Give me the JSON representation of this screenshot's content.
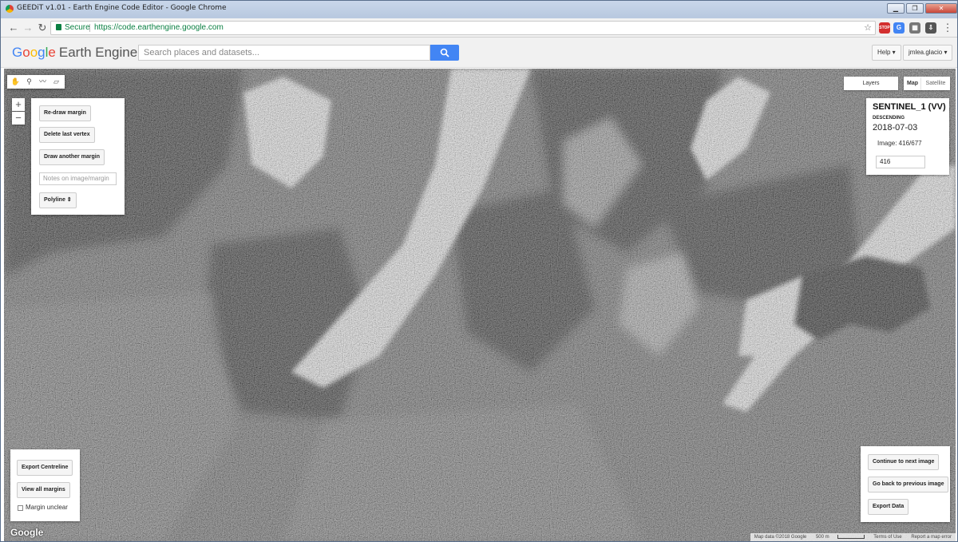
{
  "window": {
    "title": "GEEDiT v1.01 - Earth Engine Code Editor - Google Chrome"
  },
  "browser": {
    "secure_label": "Secure",
    "url": "https://code.earthengine.google.com",
    "extensions": [
      {
        "name": "stop-extension-icon",
        "label": "STOP",
        "color": "#d32f2f"
      },
      {
        "name": "translate-extension-icon",
        "label": "G",
        "color": "#4285f4"
      },
      {
        "name": "grid-extension-icon",
        "label": "▦",
        "color": "#777777"
      },
      {
        "name": "save-extension-icon",
        "label": "⇩",
        "color": "#555555"
      }
    ]
  },
  "header": {
    "logo_google": [
      "G",
      "o",
      "o",
      "g",
      "l",
      "e"
    ],
    "logo_product": "Earth Engine",
    "search_placeholder": "Search places and datasets...",
    "help_label": "Help ▾",
    "user_label": "jmlea.glacio ▾"
  },
  "map": {
    "tools": [
      "hand-tool-icon",
      "marker-tool-icon",
      "line-tool-icon",
      "polygon-tool-icon"
    ],
    "zoom_in": "+",
    "zoom_out": "−",
    "layers_label": "Layers",
    "map_label": "Map",
    "satellite_label": "Satellite",
    "google_mark": "Google",
    "attribution": {
      "map_data": "Map data ©2018 Google",
      "scale": "500 m",
      "terms": "Terms of Use",
      "report": "Report a map error"
    }
  },
  "digitize_panel": {
    "redraw": "Re-draw margin",
    "delete_vertex": "Delete last vertex",
    "draw_another": "Draw another margin",
    "notes_placeholder": "Notes on image/margin",
    "geometry_select": "Polyline"
  },
  "image_info": {
    "title": "SENTINEL_1 (VV)",
    "orbit": "DESCENDING",
    "date": "2018-07-03",
    "image_counter": "Image: 416/677",
    "image_number_input": "416"
  },
  "export_panel": {
    "export_centreline": "Export Centreline",
    "view_all": "View all margins",
    "margin_unclear": "Margin unclear"
  },
  "nav_panel": {
    "next": "Continue to next image",
    "previous": "Go back to previous image",
    "export_data": "Export Data"
  }
}
